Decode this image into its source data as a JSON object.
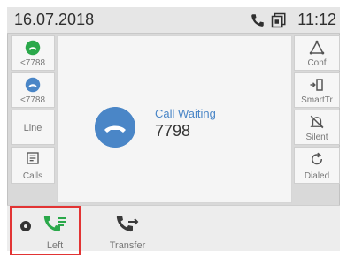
{
  "status_bar": {
    "date": "16.07.2018",
    "time": "11:12"
  },
  "left_keys": [
    {
      "label": "<7788"
    },
    {
      "label": "<7788"
    },
    {
      "label": "Line"
    },
    {
      "label": "Calls"
    }
  ],
  "right_keys": [
    {
      "label": "Conf"
    },
    {
      "label": "SmartTr"
    },
    {
      "label": "Silent"
    },
    {
      "label": "Dialed"
    }
  ],
  "call": {
    "status": "Call Waiting",
    "number": "7798"
  },
  "softkeys": {
    "left": "Left",
    "transfer": "Transfer"
  },
  "colors": {
    "accent": "#4a86c7",
    "green": "#2aa84a",
    "highlight": "#e23434"
  }
}
